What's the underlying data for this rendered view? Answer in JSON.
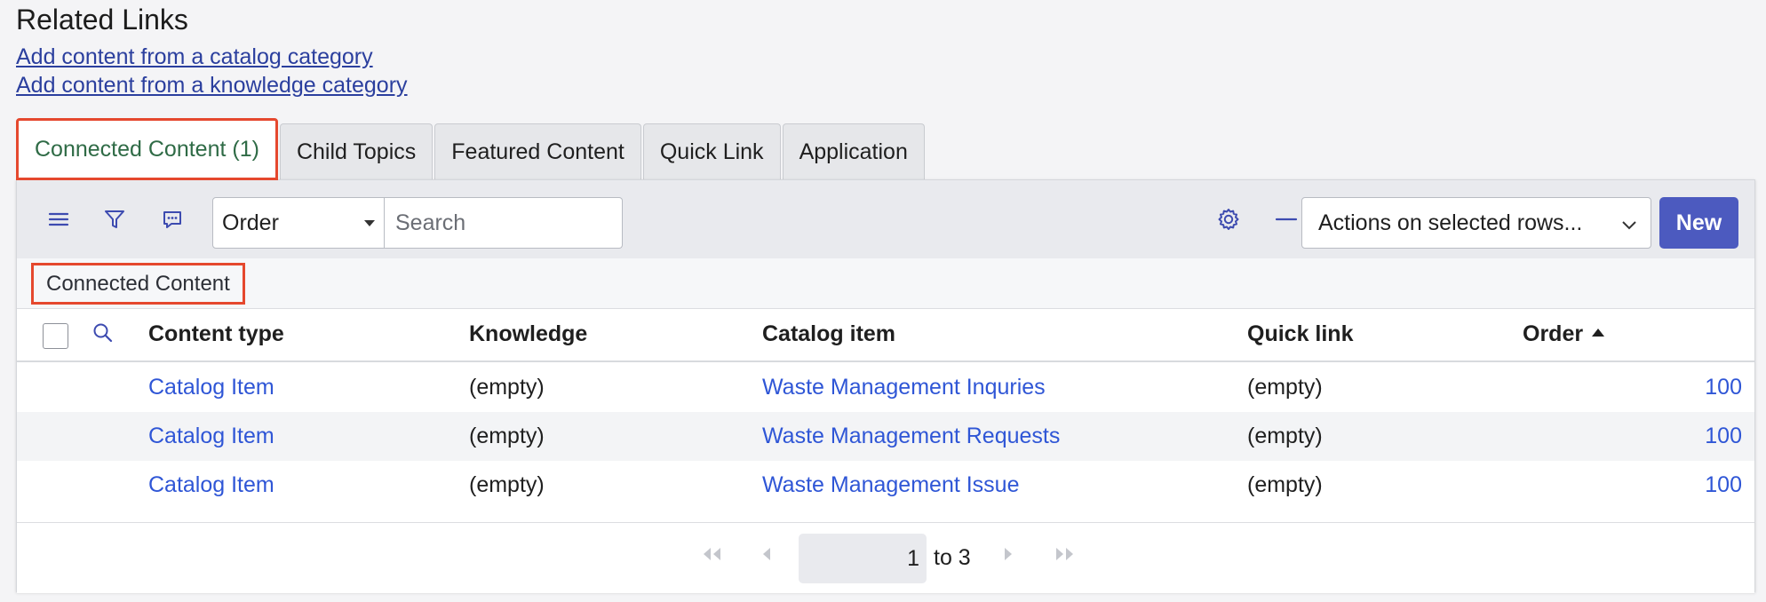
{
  "section_title": "Related Links",
  "related_links": [
    "Add content from a catalog category",
    "Add content from a knowledge category"
  ],
  "tabs": [
    {
      "label": "Connected Content (1)",
      "active": true
    },
    {
      "label": "Child Topics"
    },
    {
      "label": "Featured Content"
    },
    {
      "label": "Quick Link"
    },
    {
      "label": "Application"
    }
  ],
  "toolbar": {
    "order_select": "Order",
    "search_placeholder": "Search",
    "actions_select": "Actions on selected rows...",
    "new_label": "New"
  },
  "breadcrumb": "Connected Content",
  "table": {
    "columns": [
      "Content type",
      "Knowledge",
      "Catalog item",
      "Quick link",
      "Order"
    ],
    "sorted_column": "Order",
    "rows": [
      {
        "type": "Catalog Item",
        "knowledge": "(empty)",
        "catalog": "Waste Management Inquries",
        "quick": "(empty)",
        "order": "100"
      },
      {
        "type": "Catalog Item",
        "knowledge": "(empty)",
        "catalog": "Waste Management Requests",
        "quick": "(empty)",
        "order": "100"
      },
      {
        "type": "Catalog Item",
        "knowledge": "(empty)",
        "catalog": "Waste Management Issue",
        "quick": "(empty)",
        "order": "100"
      }
    ]
  },
  "pagination": {
    "current": "1",
    "to_label": "to 3"
  },
  "colors": {
    "accent": "#4c5abf",
    "link": "#2f56d6",
    "highlight_border": "#e5482e",
    "active_tab_text": "#2f6b46"
  }
}
